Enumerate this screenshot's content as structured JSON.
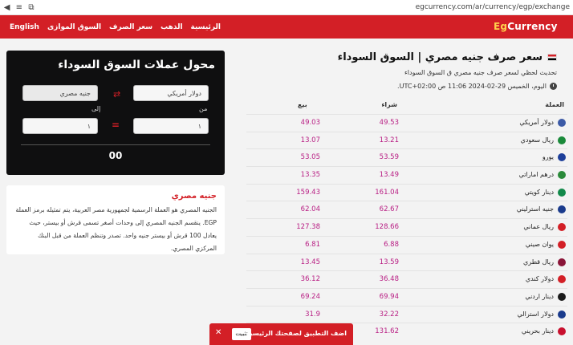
{
  "browser": {
    "url": "egcurrency.com/ar/currency/egp/exchange"
  },
  "nav": {
    "links": [
      "English",
      "السوق الموازى",
      "سعر الصرف",
      "الذهب",
      "الرئيسية"
    ],
    "logo_part1": "Eg",
    "logo_part2": "Currency"
  },
  "converter": {
    "title": "محول عملات السوق السوداء",
    "from_currency": "دولار أمريكي",
    "to_currency": "جنيه مصري",
    "from_label": "من",
    "to_label": "إلى",
    "from_value": "١",
    "to_value": "١",
    "result": "00"
  },
  "info": {
    "title": "جنيه مصري",
    "text": "الجنيه المصري هو العملة الرسمية لجمهورية مصر العربية، يتم تمثيله برمز العملة EGP. ينقسم الجنيه المصري إلى وحدات أصغر تسمى قرش أو بيستر، حيث يعادل 100 قرش أو بيستر جنيه واحد. تصدر وتنظم العملة من قبل البنك المركزي المصري."
  },
  "main": {
    "title": "سعر صرف جنيه مصري | السوق السوداء",
    "subtitle": "تحديث لحظي لسعر صرف جنيه مصري ق السوق السوداء",
    "updated": "اليوم، الخميس 29-02-2024 11:06 ص UTC+02:00."
  },
  "table": {
    "headers": {
      "currency": "العملة",
      "buy": "شراء",
      "sell": "بيع"
    },
    "rows": [
      {
        "name": "دولار أمريكي",
        "buy": "49.53",
        "sell": "49.03",
        "flag_color": "#3c5aa6"
      },
      {
        "name": "ريال سعودي",
        "buy": "13.21",
        "sell": "13.07",
        "flag_color": "#1a8a3a"
      },
      {
        "name": "يورو",
        "buy": "53.59",
        "sell": "53.05",
        "flag_color": "#1d3f9a"
      },
      {
        "name": "درهم اماراتي",
        "buy": "13.49",
        "sell": "13.35",
        "flag_color": "#2a8a3a"
      },
      {
        "name": "دينار كويتي",
        "buy": "161.04",
        "sell": "159.43",
        "flag_color": "#12894a"
      },
      {
        "name": "جنيه استرليني",
        "buy": "62.67",
        "sell": "62.04",
        "flag_color": "#1a3b8c"
      },
      {
        "name": "ريال عماني",
        "buy": "128.66",
        "sell": "127.38",
        "flag_color": "#d31f26"
      },
      {
        "name": "يوان صيني",
        "buy": "6.88",
        "sell": "6.81",
        "flag_color": "#d31f26"
      },
      {
        "name": "ريال قطري",
        "buy": "13.59",
        "sell": "13.45",
        "flag_color": "#8a1538"
      },
      {
        "name": "دولار كندي",
        "buy": "36.48",
        "sell": "36.12",
        "flag_color": "#d31f26"
      },
      {
        "name": "دينار اردني",
        "buy": "69.94",
        "sell": "69.24",
        "flag_color": "#1a1a1a"
      },
      {
        "name": "دولار استرالي",
        "buy": "32.22",
        "sell": "31.9",
        "flag_color": "#1a3b8c"
      },
      {
        "name": "دينار بحريني",
        "buy": "131.62",
        "sell": "",
        "flag_color": "#c8102e"
      }
    ]
  },
  "banner": {
    "text": "اضف التطبيق لصفحتك الرئيسية",
    "button": "تثبيت",
    "close": "✕"
  },
  "colors": {
    "accent": "#d31f26",
    "rate": "#b81d83",
    "converter_bg": "#0f0f10"
  }
}
